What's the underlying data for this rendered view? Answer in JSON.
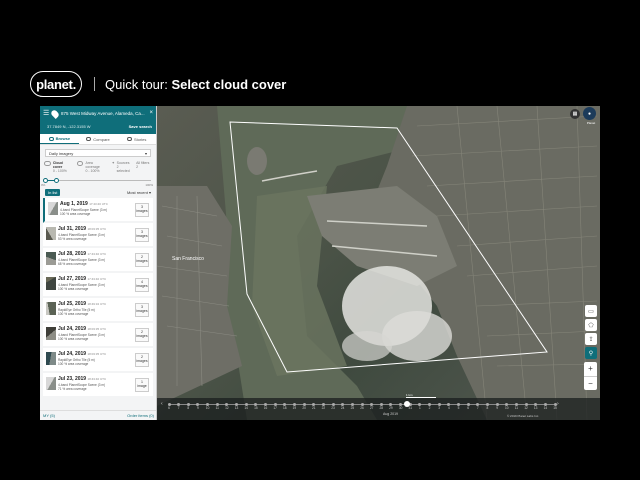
{
  "header": {
    "logo_text": "planet.",
    "tour_prefix": "Quick tour: ",
    "tour_title": "Select cloud cover"
  },
  "panel": {
    "address": "875 West Midway Avenue, Alameda, Ca...",
    "coordinates": "37.7849 N, -122.3155 W",
    "save_search": "Save search",
    "tabs": [
      {
        "label": "Browse",
        "icon": "eye-icon"
      },
      {
        "label": "Compare",
        "icon": "compare-icon"
      },
      {
        "label": "Stories",
        "icon": "play-icon"
      }
    ],
    "filter_value": "Daily imagery",
    "stats": [
      {
        "label": "Cloud cover",
        "value": "0 - 100%"
      },
      {
        "label": "Area coverage",
        "value": "0 - 100%"
      },
      {
        "label": "Sources",
        "value": "2 selected"
      },
      {
        "label": "All filters",
        "value": "2"
      }
    ],
    "slider": {
      "min_label": "0%",
      "max_label": "100%",
      "value": 0.1
    },
    "in_list_label": "In list",
    "sort_label": "Most recent",
    "scenes": [
      {
        "date": "Aug 1, 2019",
        "time": "17:43:40 UTC",
        "line1": "4-band PlanetScope Scene (3 m)",
        "line2": "100 % area coverage",
        "count": "3",
        "unit": "images"
      },
      {
        "date": "Jul 31, 2019",
        "time": "18:03:35 UTC",
        "line1": "4-band PlanetScope Scene (3 m)",
        "line2": "53 % area coverage",
        "count": "3",
        "unit": "images"
      },
      {
        "date": "Jul 28, 2019",
        "time": "17:43:40 UTC",
        "line1": "4-band PlanetScope Scene (3 m)",
        "line2": "68 % area coverage",
        "count": "2",
        "unit": "images"
      },
      {
        "date": "Jul 27, 2019",
        "time": "17:43:40 UTC",
        "line1": "4-band PlanetScope Scene (3 m)",
        "line2": "100 % area coverage",
        "count": "4",
        "unit": "images"
      },
      {
        "date": "Jul 25, 2019",
        "time": "18:49:32 UTC",
        "line1": "RapidEye Ortho Tile (5 m)",
        "line2": "100 % area coverage",
        "count": "3",
        "unit": "images"
      },
      {
        "date": "Jul 24, 2019",
        "time": "18:03:35 UTC",
        "line1": "4-band PlanetScope Scene (3 m)",
        "line2": "100 % area coverage",
        "count": "2",
        "unit": "images"
      },
      {
        "date": "Jul 24, 2019",
        "time": "18:03:35 UTC",
        "line1": "RapidEye Ortho Tile (5 m)",
        "line2": "100 % area coverage",
        "count": "2",
        "unit": "images"
      },
      {
        "date": "Jul 23, 2019",
        "time": "18:43:40 UTC",
        "line1": "4-band PlanetScope Scene (3 m)",
        "line2": "71 % area coverage",
        "count": "1",
        "unit": "image"
      }
    ],
    "footer_left": "MY (5)",
    "footer_right": "Order items (0)"
  },
  "map": {
    "city_label": "San Francisco",
    "account_label": "Planet"
  },
  "timeline": {
    "days": [
      "6",
      "7",
      "8",
      "9",
      "10",
      "11",
      "12",
      "13",
      "14",
      "15",
      "16",
      "17",
      "18",
      "19",
      "20",
      "21",
      "22",
      "23",
      "24",
      "25",
      "26",
      "27",
      "28",
      "29",
      "30",
      "31",
      "1",
      "2",
      "3",
      "4",
      "5",
      "6",
      "7",
      "8",
      "9",
      "10",
      "11",
      "12",
      "13",
      "14",
      "15"
    ],
    "month_label": "Aug 2019",
    "attribution": "© 2019 Planet Labs Inc.",
    "scale_label": "1 km"
  },
  "colors": {
    "accent": "#0f6e7a",
    "aoi": "#ffffff"
  }
}
